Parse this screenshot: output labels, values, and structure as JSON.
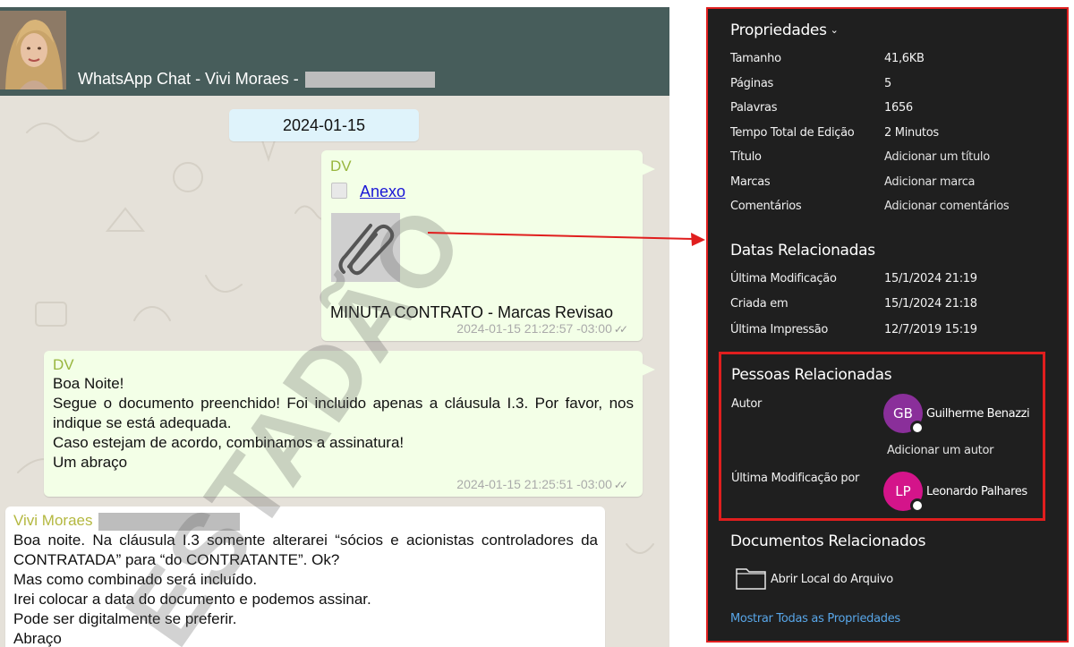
{
  "chat": {
    "header_title": "WhatsApp Chat - Vivi Moraes -",
    "date_chip": "2024-01-15",
    "messages": [
      {
        "sender": "DV",
        "attachment_label": "Anexo",
        "attachment_icon": "paperclip-icon",
        "file_name": "MINUTA CONTRATO - Marcas Revisao",
        "time": "2024-01-15 21:22:57 -03:00",
        "ticks": "✓✓"
      },
      {
        "sender": "DV",
        "lines": [
          "Boa Noite!",
          "Segue o documento preenchido! Foi incluido apenas a cláusula I.3. Por favor, nos indique se está adequada.",
          "Caso estejam de acordo, combinamos a assinatura!",
          "Um abraço"
        ],
        "time": "2024-01-15 21:25:51 -03:00",
        "ticks": "✓✓"
      },
      {
        "sender": "Vivi Moraes",
        "lines": [
          "Boa noite. Na cláusula I.3 somente alterarei “sócios e acionistas controladores da CONTRATADA” para “do CONTRATANTE”. Ok?",
          "Mas como combinado será incluído.",
          "Irei colocar a data do documento e podemos assinar.",
          "Pode ser digitalmente se preferir.",
          "Abraço"
        ]
      }
    ]
  },
  "watermark": "ESTADÃO",
  "properties": {
    "heading": "Propriedades",
    "rows": [
      {
        "label": "Tamanho",
        "value": "41,6KB"
      },
      {
        "label": "Páginas",
        "value": "5"
      },
      {
        "label": "Palavras",
        "value": "1656"
      },
      {
        "label": "Tempo Total de Edição",
        "value": "2 Minutos"
      },
      {
        "label": "Título",
        "value": "Adicionar um título"
      },
      {
        "label": "Marcas",
        "value": "Adicionar marca"
      },
      {
        "label": "Comentários",
        "value": "Adicionar comentários"
      }
    ],
    "dates_heading": "Datas Relacionadas",
    "dates": [
      {
        "label": "Última Modificação",
        "value": "15/1/2024 21:19"
      },
      {
        "label": "Criada em",
        "value": "15/1/2024 21:18"
      },
      {
        "label": "Última Impressão",
        "value": "12/7/2019 15:19"
      }
    ],
    "people_heading": "Pessoas Relacionadas",
    "author_label": "Autor",
    "author": {
      "initials": "GB",
      "name": "Guilherme Benazzi",
      "color": "#8a2f9a"
    },
    "add_author": "Adicionar um autor",
    "modified_by_label": "Última Modificação por",
    "modified_by": {
      "initials": "LP",
      "name": "Leonardo Palhares",
      "color": "#d4148a"
    },
    "docs_heading": "Documentos Relacionados",
    "open_location": "Abrir Local do Arquivo",
    "show_all": "Mostrar Todas as Propriedades"
  },
  "colors": {
    "wa_header": "#475d5b",
    "bubble_out": "#f3ffe7",
    "panel_bg": "#1f1f1f",
    "highlight": "#e01e1e",
    "link": "#58a6e8"
  }
}
